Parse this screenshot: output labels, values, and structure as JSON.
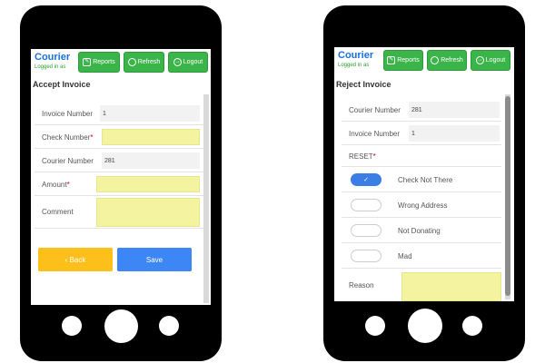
{
  "app": {
    "brand": "Courier",
    "logged_in": "Logged in as",
    "nav": {
      "reports": "Reports",
      "refresh": "Refresh",
      "logout": "Logout"
    }
  },
  "accept": {
    "title": "Accept Invoice",
    "fields": {
      "invoice_number_label": "Invoice Number",
      "invoice_number_value": "1",
      "check_number_label": "Check Number",
      "courier_number_label": "Courier Number",
      "courier_number_value": "281",
      "amount_label": "Amount",
      "comment_label": "Comment"
    },
    "required_mark": "*",
    "back_label": "‹ Back",
    "save_label": "Save"
  },
  "reject": {
    "title": "Reject Invoice",
    "fields": {
      "courier_number_label": "Courier Number",
      "courier_number_value": "281",
      "invoice_number_label": "Invoice Number",
      "invoice_number_value": "1"
    },
    "reset_label": "RESET",
    "required_mark": "*",
    "options": [
      {
        "label": "Check Not There",
        "checked": true
      },
      {
        "label": "Wrong Address",
        "checked": false
      },
      {
        "label": "Not Donating",
        "checked": false
      },
      {
        "label": "Mad",
        "checked": false
      }
    ],
    "reason_label": "Reason",
    "check_glyph": "✓"
  },
  "colors": {
    "brand_blue": "#1a6fd9",
    "nav_green": "#3bb44a",
    "input_yellow": "#f3f3a0",
    "back_button": "#fdbf1a",
    "save_button": "#3d86f5",
    "toggle_on": "#3b7ee6"
  },
  "icons": {
    "reports": "reports-icon",
    "refresh": "refresh-icon",
    "logout": "logout-icon"
  }
}
